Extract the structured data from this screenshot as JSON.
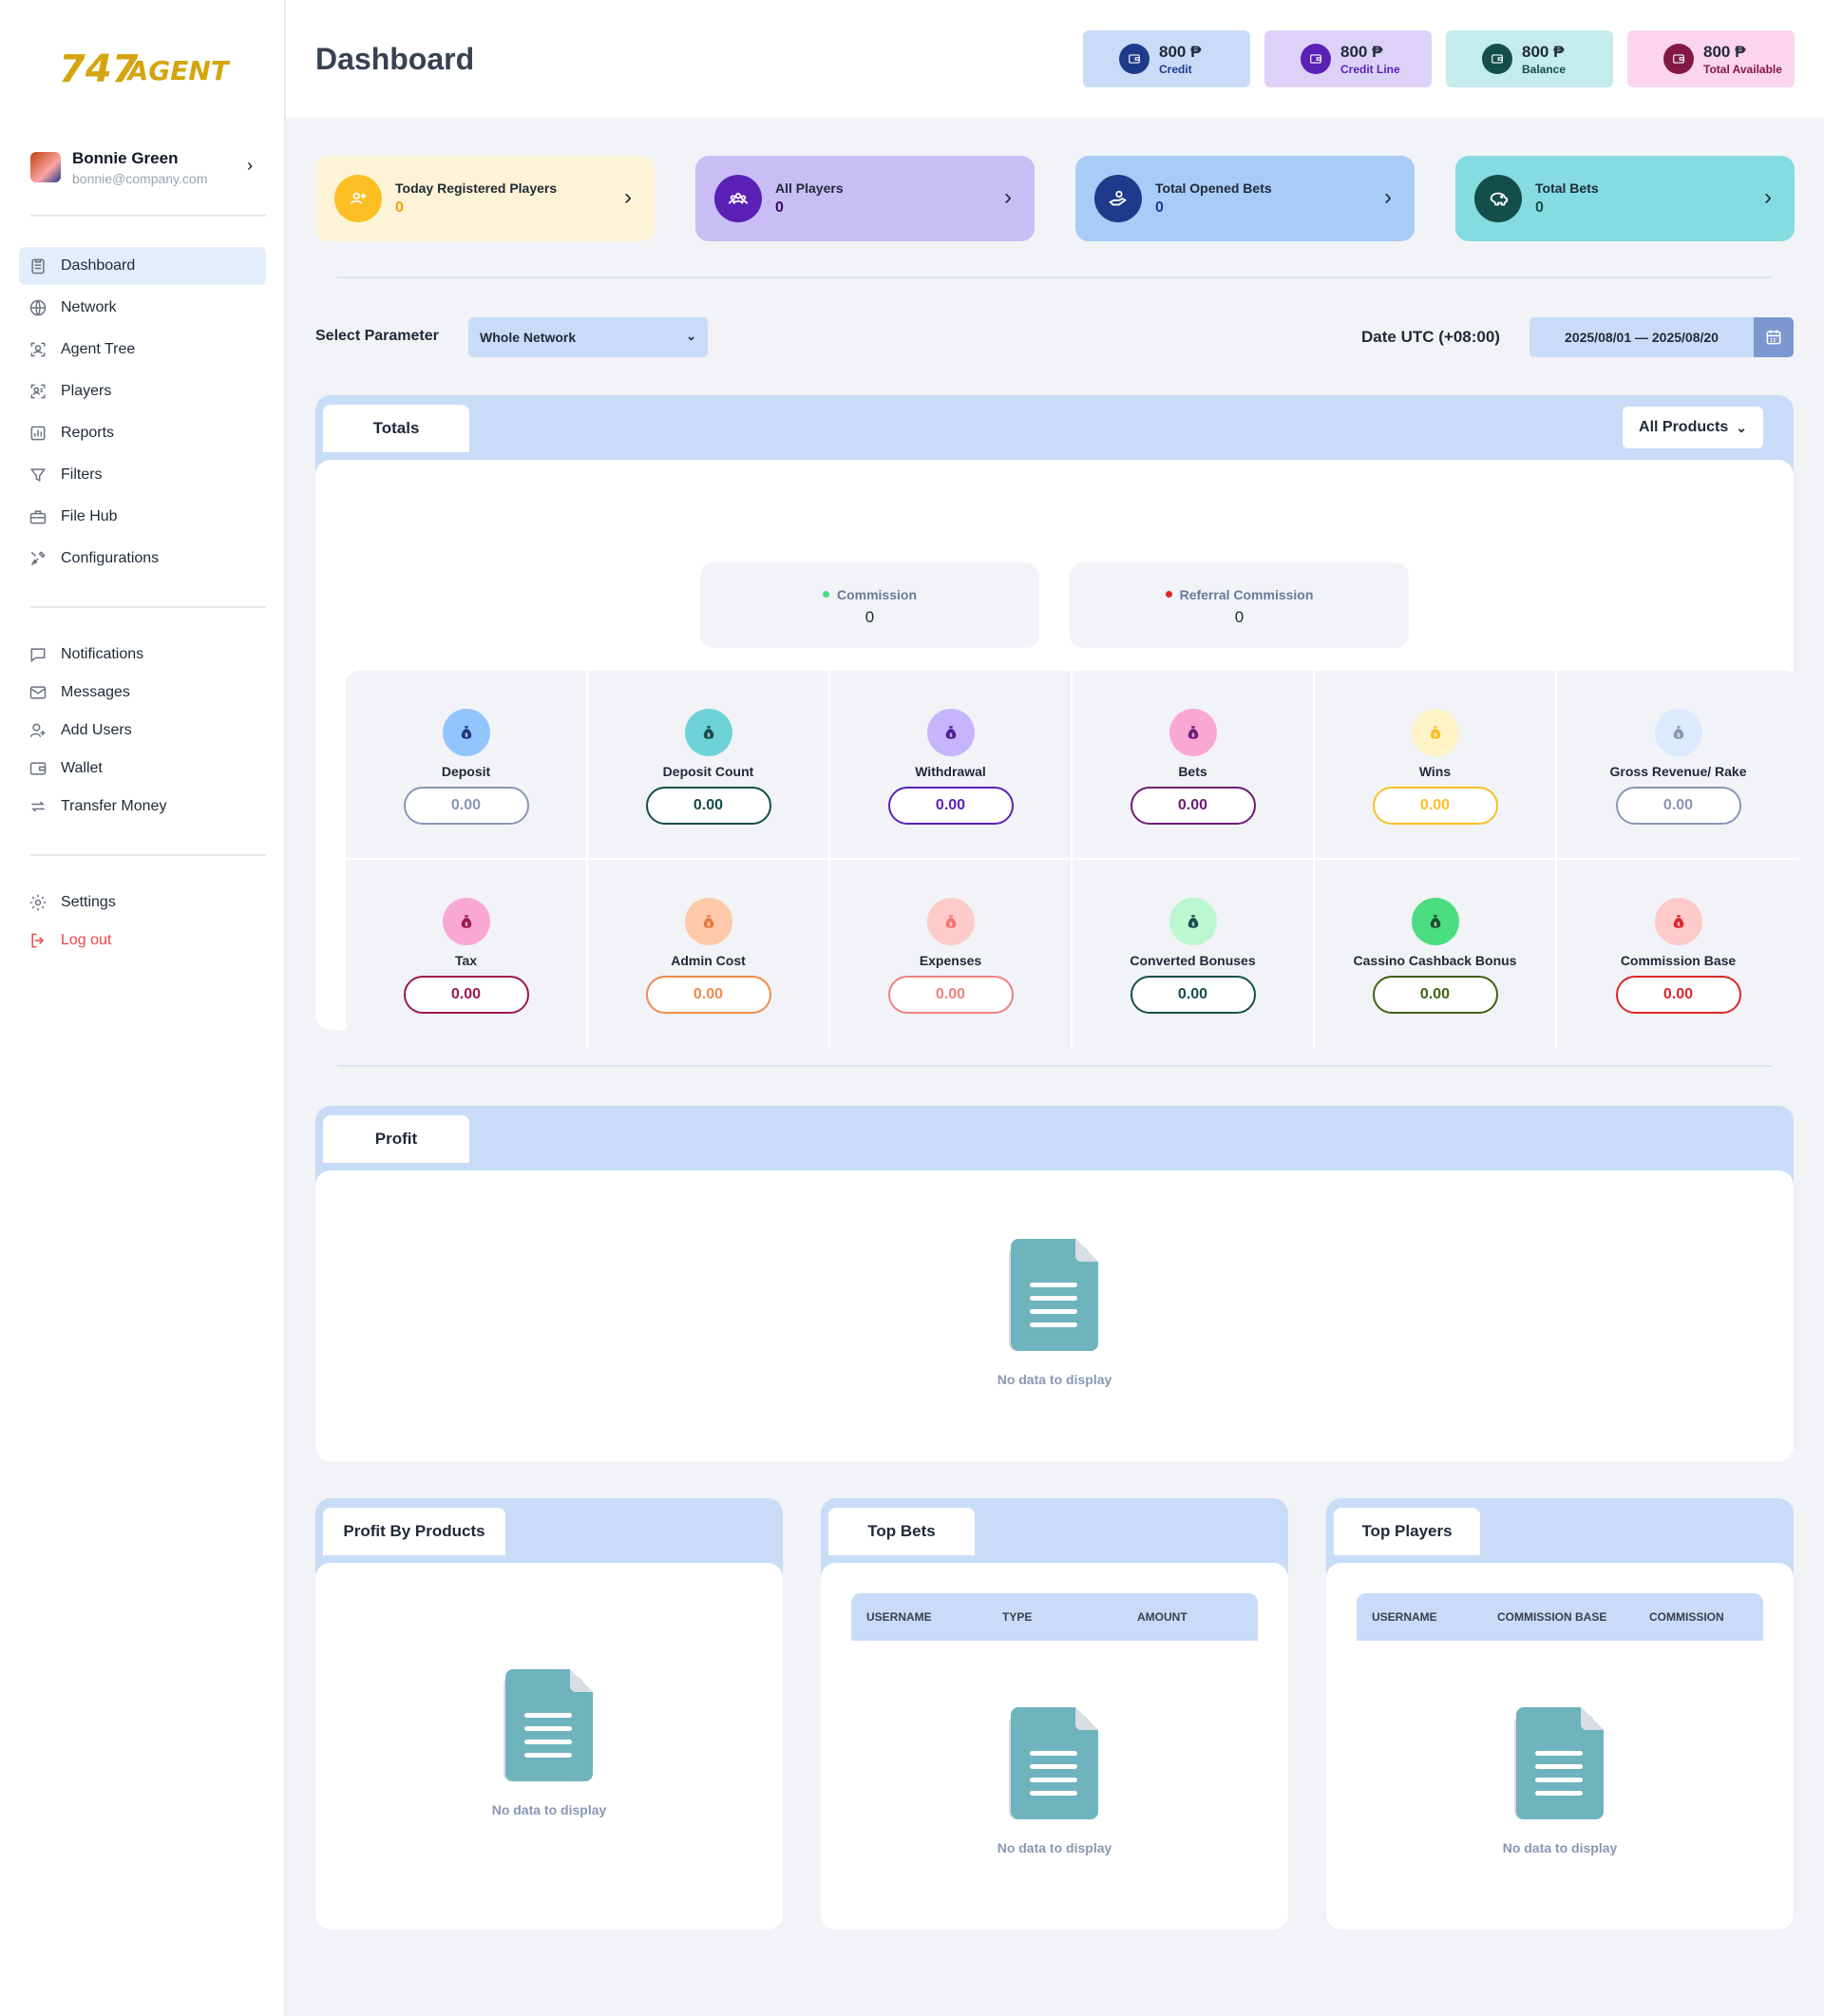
{
  "brand": {
    "logo_text": "747.AGENT"
  },
  "user": {
    "name": "Bonnie Green",
    "email": "bonnie@company.com"
  },
  "nav_main": [
    {
      "label": "Dashboard",
      "icon": "clipboard-icon",
      "active": true
    },
    {
      "label": "Network",
      "icon": "globe-icon"
    },
    {
      "label": "Agent Tree",
      "icon": "agent-tree-icon"
    },
    {
      "label": "Players",
      "icon": "players-icon"
    },
    {
      "label": "Reports",
      "icon": "reports-icon"
    },
    {
      "label": "Filters",
      "icon": "filter-icon"
    },
    {
      "label": "File Hub",
      "icon": "briefcase-icon"
    },
    {
      "label": "Configurations",
      "icon": "tools-icon"
    }
  ],
  "nav_secondary": [
    {
      "label": "Notifications",
      "icon": "chat-icon"
    },
    {
      "label": "Messages",
      "icon": "mail-icon"
    },
    {
      "label": "Add Users",
      "icon": "user-plus-icon"
    },
    {
      "label": "Wallet",
      "icon": "wallet-icon"
    },
    {
      "label": "Transfer Money",
      "icon": "transfer-icon"
    }
  ],
  "nav_bottom": {
    "settings": "Settings",
    "logout": "Log out"
  },
  "header": {
    "title": "Dashboard",
    "wallets": [
      {
        "amount": "800 ₱",
        "label": "Credit",
        "bg": "#c8dcf8",
        "icon_bg": "#1e3a8a",
        "label_color": "#1e3a8a"
      },
      {
        "amount": "800 ₱",
        "label": "Credit Line",
        "bg": "#dcd2f7",
        "icon_bg": "#5b21b6",
        "label_color": "#5b21b6"
      },
      {
        "amount": "800 ₱",
        "label": "Balance",
        "bg": "#c5ecec",
        "icon_bg": "#134e4a",
        "label_color": "#134e4a"
      },
      {
        "amount": "800 ₱",
        "label": "Total Available",
        "bg": "#fbd4ee",
        "icon_bg": "#831843",
        "label_color": "#831843"
      }
    ]
  },
  "stats": [
    {
      "title": "Today Registered Players",
      "value": "0",
      "bg": "#fdf3d6",
      "icon_bg": "#fbbf24",
      "value_color": "#f59e0b",
      "icon": "user-add-icon"
    },
    {
      "title": "All Players",
      "value": "0",
      "bg": "#c9bdf5",
      "icon_bg": "#5b21b6",
      "value_color": "#3b0764",
      "icon": "group-icon"
    },
    {
      "title": "Total Opened Bets",
      "value": "0",
      "bg": "#a9cbf7",
      "icon_bg": "#1e3a8a",
      "value_color": "#1e3a8a",
      "icon": "hand-coin-icon"
    },
    {
      "title": "Total Bets",
      "value": "0",
      "bg": "#84dbe0",
      "icon_bg": "#134e4a",
      "value_color": "#134e4a",
      "icon": "piggy-bank-icon"
    }
  ],
  "filters": {
    "param_label": "Select Parameter",
    "param_value": "Whole Network",
    "date_label": "Date UTC (+08:00)",
    "date_range": "2025/08/01 — 2025/08/20"
  },
  "totals": {
    "tab": "Totals",
    "products_button": "All Products",
    "commission": {
      "label": "Commission",
      "value": "0",
      "dot": "#4ade80"
    },
    "referral": {
      "label": "Referral Commission",
      "value": "0",
      "dot": "#dc2626"
    },
    "items": [
      {
        "label": "Deposit",
        "value": "0.00",
        "icon_bg": "#93c5fd",
        "icon_fg": "#1e3a8a",
        "border": "#8a96b5",
        "color": "#8a96b5"
      },
      {
        "label": "Deposit Count",
        "value": "0.00",
        "icon_bg": "#6ed3d6",
        "icon_fg": "#134e4a",
        "border": "#134e4a",
        "color": "#134e4a"
      },
      {
        "label": "Withdrawal",
        "value": "0.00",
        "icon_bg": "#c4b5fd",
        "icon_fg": "#4c1d95",
        "border": "#5b21b6",
        "color": "#5b21b6"
      },
      {
        "label": "Bets",
        "value": "0.00",
        "icon_bg": "#f9a8d4",
        "icon_fg": "#701a75",
        "border": "#701a75",
        "color": "#701a75"
      },
      {
        "label": "Wins",
        "value": "0.00",
        "icon_bg": "#fef3c7",
        "icon_fg": "#fbbf24",
        "border": "#fbbf24",
        "color": "#fbbf24"
      },
      {
        "label": "Gross Revenue/ Rake",
        "value": "0.00",
        "icon_bg": "#dbeafe",
        "icon_fg": "#8a96b5",
        "border": "#8a96b5",
        "color": "#8a96b5"
      },
      {
        "label": "Tax",
        "value": "0.00",
        "icon_bg": "#f9a8d4",
        "icon_fg": "#9d174d",
        "border": "#9d174d",
        "color": "#9d174d"
      },
      {
        "label": "Admin Cost",
        "value": "0.00",
        "icon_bg": "#fdc9a8",
        "icon_fg": "#ea7a3a",
        "border": "#f08a4b",
        "color": "#f08a4b"
      },
      {
        "label": "Expenses",
        "value": "0.00",
        "icon_bg": "#fecaca",
        "icon_fg": "#f87171",
        "border": "#f08080",
        "color": "#f08080"
      },
      {
        "label": "Converted Bonuses",
        "value": "0.00",
        "icon_bg": "#bbf7d0",
        "icon_fg": "#134e4a",
        "border": "#134e4a",
        "color": "#134e4a"
      },
      {
        "label": "Cassino Cashback Bonus",
        "value": "0.00",
        "icon_bg": "#4ade80",
        "icon_fg": "#14532d",
        "border": "#3f6212",
        "color": "#3f6212"
      },
      {
        "label": "Commission Base",
        "value": "0.00",
        "icon_bg": "#fecaca",
        "icon_fg": "#dc2626",
        "border": "#dc2626",
        "color": "#dc2626"
      }
    ]
  },
  "profit": {
    "tab": "Profit",
    "empty": "No data to display"
  },
  "profit_by_products": {
    "tab": "Profit By Products",
    "empty": "No data to display"
  },
  "top_bets": {
    "tab": "Top Bets",
    "columns": [
      "USERNAME",
      "TYPE",
      "AMOUNT"
    ],
    "empty": "No data to display"
  },
  "top_players": {
    "tab": "Top Players",
    "columns": [
      "USERNAME",
      "COMMISSION BASE",
      "COMMISSION"
    ],
    "empty": "No data to display"
  }
}
